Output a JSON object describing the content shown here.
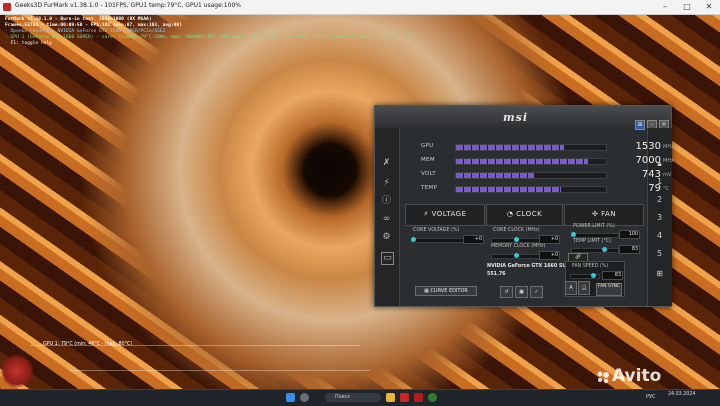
{
  "window": {
    "title": "Geeks3D FurMark v1.38.1.0 - 101FPS, GPU1 temp:79°C, GPU1 usage:100%"
  },
  "osd": {
    "lines": [
      {
        "text": "FurMark v1.38.1.0 - Burn-in test, 1920x1080 (8X MSAA)",
        "color": "#ffffff"
      },
      {
        "text": "Frames:53783 - time:00:09:50 - FPS:101 (min:87, max:103, avg:98)",
        "color": "#ffffff"
      },
      {
        "text": "- OpenGL renderer: NVIDIA GeForce GTX 1660 SUPER/PCIe/SSE2",
        "color": "#8fd1ff"
      },
      {
        "text": "- GPU 1 (GeForce GTX 1660 SUPER) - core: 1530MHz:79°C:100%, mem: 7000MHz:76%, GPU power: 100.2% TDP, fan: 67%, limits:[power:1, temp:0, volt:0, OV:0]",
        "color": "#7fe08a"
      },
      {
        "text": "- F1: toggle help",
        "color": "#ffffff"
      }
    ],
    "graph_label": "GPU 1: 79°C (min: 46°C - max: 80°C)"
  },
  "afterburner": {
    "brand": "msi",
    "monitors": [
      {
        "label": "GPU",
        "value": "1530",
        "unit": "MHz",
        "fill_pct": 72
      },
      {
        "label": "MEM",
        "value": "7000",
        "unit": "MHz",
        "fill_pct": 88
      },
      {
        "label": "VOLT",
        "value": "743",
        "unit": "mV",
        "fill_pct": 52
      },
      {
        "label": "TEMP",
        "value": "79",
        "unit": "°C",
        "fill_pct": 70
      }
    ],
    "panels": {
      "voltage": "VOLTAGE",
      "clock": "CLOCK",
      "fan": "FAN"
    },
    "voltage": {
      "core_voltage_label": "CORE VOLTAGE (%)",
      "core_voltage_value": "+0",
      "curve_editor": "CURVE EDITOR"
    },
    "clock": {
      "core_clock_label": "CORE CLOCK (MHz)",
      "core_clock_value": "+0",
      "memory_clock_label": "MEMORY CLOCK (MHz)",
      "memory_clock_value": "+0",
      "gpu_name": "NVIDIA GeForce GTX 1660 SUPER",
      "driver": "551.76"
    },
    "fan": {
      "power_limit_label": "POWER LIMIT (%)",
      "power_limit_value": "100",
      "temp_limit_label": "TEMP LIMIT (°C)",
      "temp_limit_value": "83",
      "fan_speed_label": "FAN SPEED (%)",
      "fan_speed_value": "83",
      "fan_sync": "FAN SYNC",
      "auto": "A"
    },
    "right_numbers": [
      "1",
      "2",
      "3",
      "4",
      "5"
    ]
  },
  "taskbar": {
    "search_placeholder": "Поиск",
    "language": "РУС",
    "time": "",
    "date": "24.03.2024"
  },
  "watermark": "Avito"
}
